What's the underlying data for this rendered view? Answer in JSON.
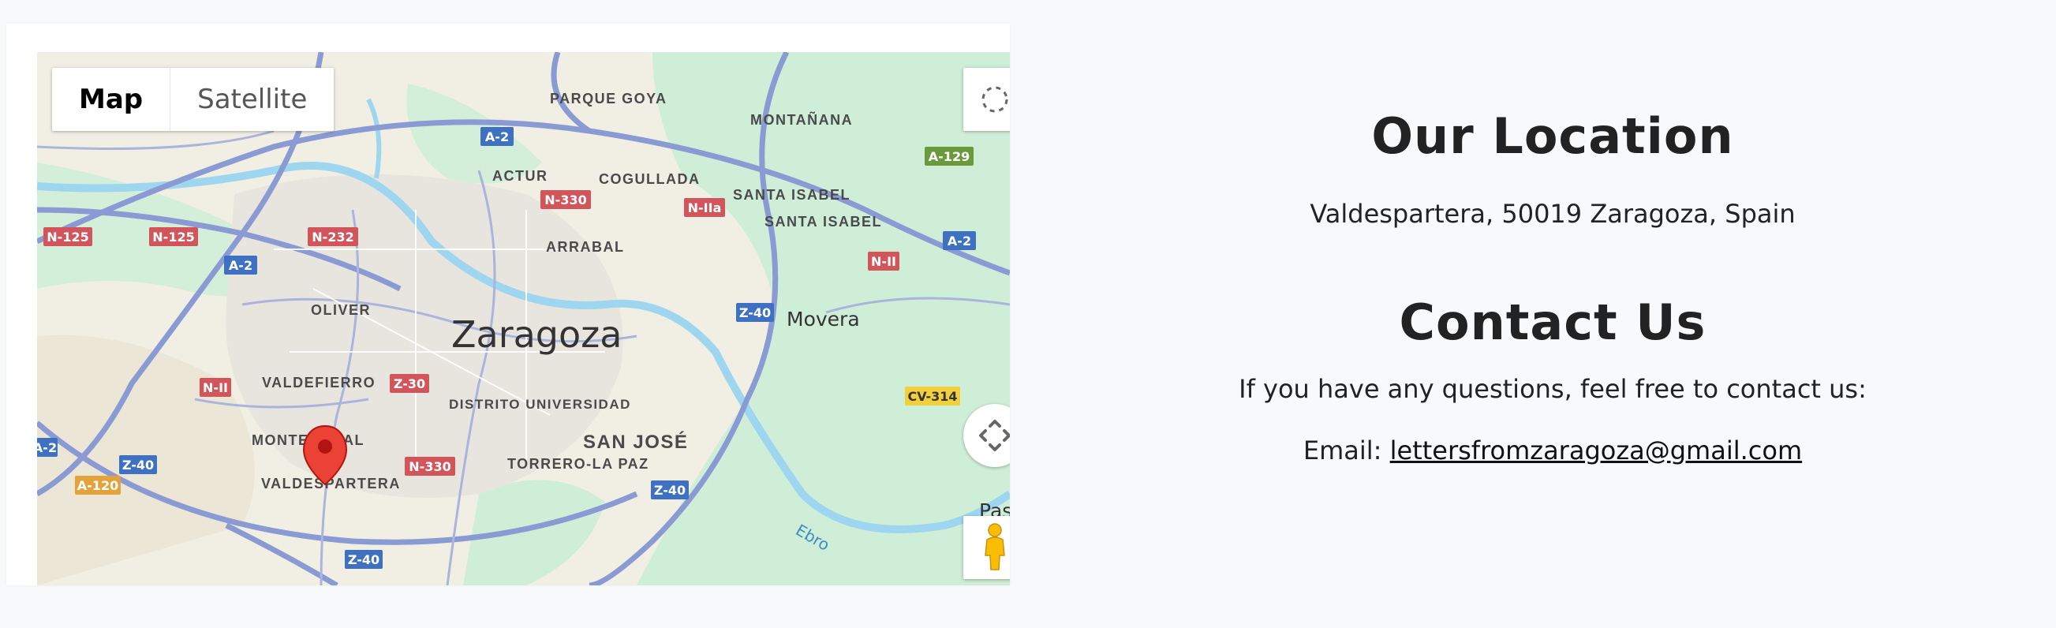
{
  "map": {
    "type_control": {
      "map_label": "Map",
      "satellite_label": "Satellite"
    },
    "city_label": "Zaragoza",
    "place_labels": {
      "parque_goya": "PARQUE GOYA",
      "montanana": "MONTAÑANA",
      "actur": "ACTUR",
      "cogullada": "COGULLADA",
      "santa_isabel": "SANTA ISABEL",
      "arrabal": "ARRABAL",
      "movera": "Movera",
      "oliver": "OLIVER",
      "valdefierro": "VALDEFIERRO",
      "distrito_universidad": "DISTRITO UNIVERSIDAD",
      "san_jose": "SAN JOSÉ",
      "torrero_la_paz": "TORRERO-LA PAZ",
      "montecanal": "MONTECANAL",
      "valdespartera": "VALDESPARTERA",
      "ebro": "Ebro",
      "pastriz_partial": "Pas"
    },
    "road_shields": {
      "a2_top": "A-2",
      "n330_top": "N-330",
      "n2a": "N-IIa",
      "a129": "A-129",
      "n125_a": "N-125",
      "n125_b": "N-125",
      "n232": "N-232",
      "a2_left": "A-2",
      "a2_right": "A-2",
      "n2_right": "N-II",
      "z40_center": "Z-40",
      "n2_left": "N-II",
      "z30": "Z-30",
      "cv314": "CV-314",
      "n330_bottom": "N-330",
      "a2_bottomleft": "A-2",
      "z40_left": "Z-40",
      "a120": "A-120",
      "z40_bottom": "Z-40",
      "z40_bottomcenter": "Z-40"
    },
    "colors": {
      "land": "#f1efe4",
      "park": "#c9ecd3",
      "urban": "#e9e6df",
      "water": "#9ed6f0",
      "motorway": "#8a9ad3",
      "shield_blue": "#3e71c2",
      "shield_red": "#d1555a",
      "shield_green": "#6a9a3c",
      "shield_yellow": "#f2d03c",
      "shield_orange": "#e5a23b",
      "marker": "#ea4335"
    }
  },
  "location": {
    "heading": "Our Location",
    "address": "Valdespartera, 50019 Zaragoza, Spain"
  },
  "contact": {
    "heading": "Contact Us",
    "intro": "If you have any questions, feel free to contact us:",
    "email_prefix": "Email:",
    "email": "lettersfromzaragoza@gmail.com"
  }
}
